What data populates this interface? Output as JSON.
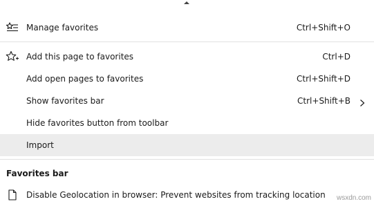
{
  "menu": {
    "items_group_1": [
      {
        "label": "Manage favorites",
        "shortcut": "Ctrl+Shift+O",
        "icon": "manage-favorites-icon"
      }
    ],
    "items_group_2": [
      {
        "label": "Add this page to favorites",
        "shortcut": "Ctrl+D",
        "icon": "star-add-icon"
      },
      {
        "label": "Add open pages to favorites",
        "shortcut": "Ctrl+Shift+D"
      },
      {
        "label": "Show favorites bar",
        "shortcut": "Ctrl+Shift+B",
        "has_submenu": true
      },
      {
        "label": "Hide favorites button from toolbar",
        "shortcut": ""
      },
      {
        "label": "Import",
        "shortcut": "",
        "highlighted": true
      }
    ]
  },
  "favorites_bar": {
    "heading": "Favorites bar",
    "items": [
      {
        "label": "Disable Geolocation in browser: Prevent websites from tracking location",
        "icon": "page-icon"
      }
    ]
  },
  "watermark": "wsxdn.com"
}
